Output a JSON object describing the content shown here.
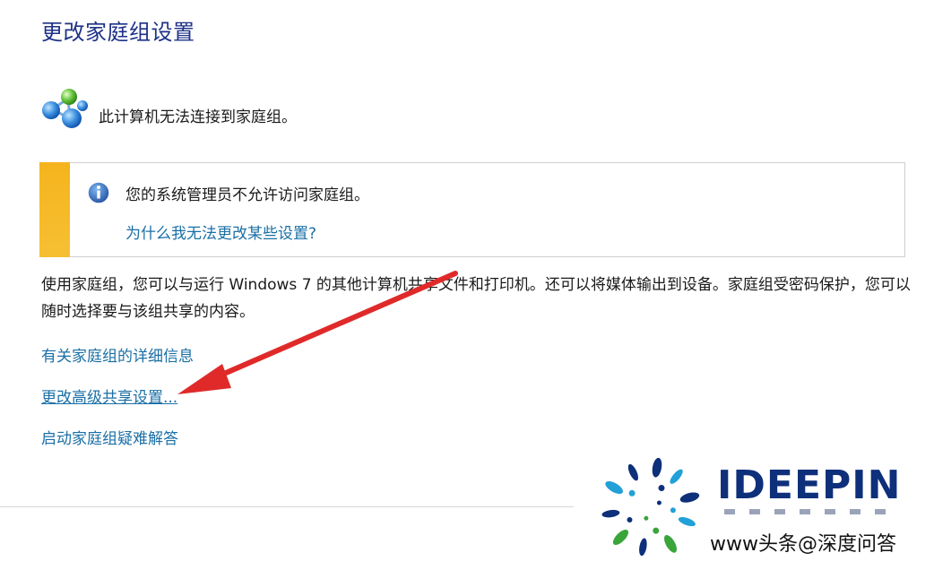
{
  "page": {
    "title": "更改家庭组设置"
  },
  "status": {
    "icon": "homegroup-network-icon",
    "message": "此计算机无法连接到家庭组。"
  },
  "info_panel": {
    "icon": "info-icon",
    "accent_color": "#f5b41d",
    "message": "您的系统管理员不允许访问家庭组。",
    "link": "为什么我无法更改某些设置?"
  },
  "description": "使用家庭组，您可以与运行 Windows 7 的其他计算机共享文件和打印机。还可以将媒体输出到设备。家庭组受密码保护，您可以随时选择要与该组共享的内容。",
  "links": {
    "details": "有关家庭组的详细信息",
    "advanced_sharing": "更改高级共享设置...",
    "troubleshoot": "启动家庭组疑难解答"
  },
  "annotation": {
    "icon": "red-arrow-icon",
    "color": "#e02a2a"
  },
  "watermark": {
    "logo_icon": "ideepin-swirl-logo",
    "brand": "IDEEPIN",
    "credit": "www头条@深度问答"
  },
  "colors": {
    "title": "#1e3287",
    "link": "#1a6fa6"
  }
}
